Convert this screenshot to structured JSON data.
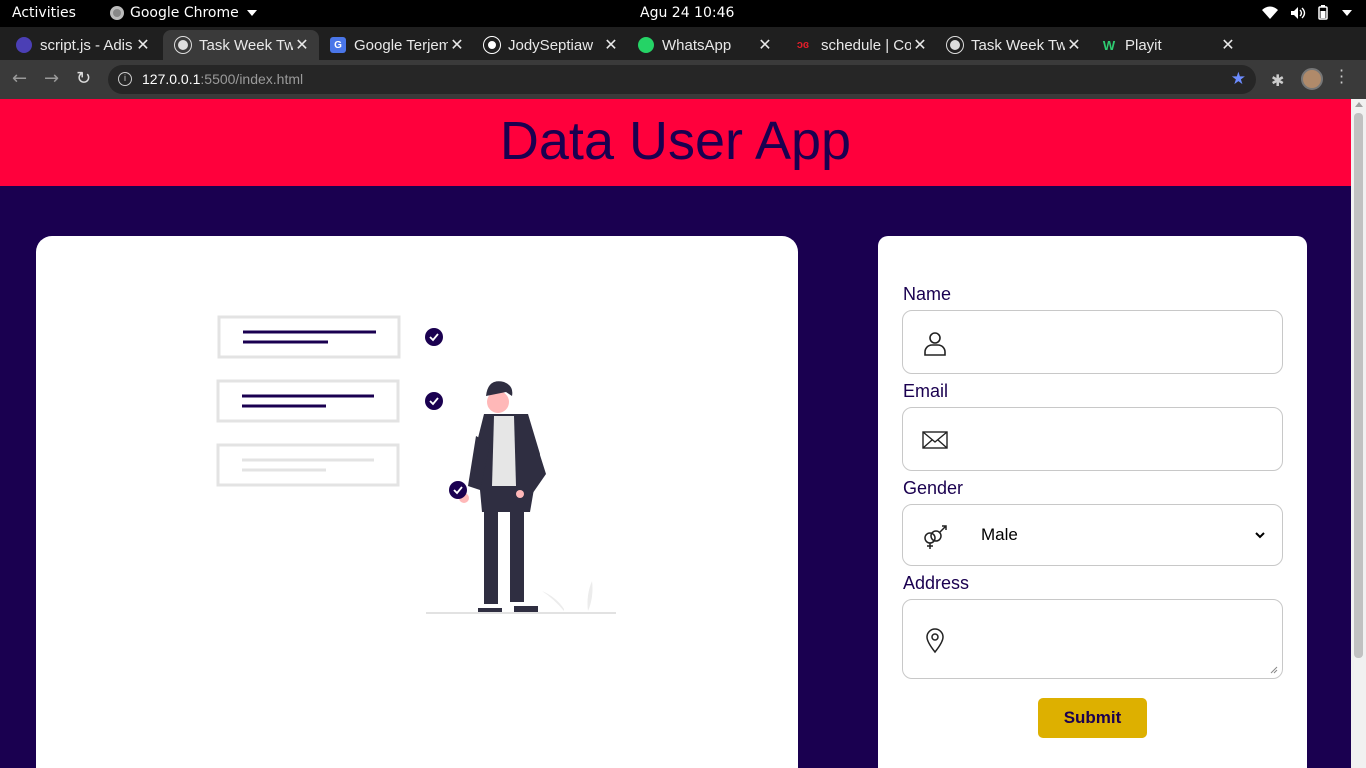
{
  "system": {
    "activities": "Activities",
    "app_name": "Google Chrome",
    "clock": "Agu 24  10:46"
  },
  "browser": {
    "tabs": [
      {
        "title": "script.js - Adis",
        "icon": "github-icon",
        "active": false
      },
      {
        "title": "Task Week Tw",
        "icon": "globe-icon",
        "active": true
      },
      {
        "title": "Google Terjem",
        "icon": "google-translate-icon",
        "active": false
      },
      {
        "title": "JodySeptiaw",
        "icon": "github-icon",
        "active": false
      },
      {
        "title": "WhatsApp",
        "icon": "whatsapp-icon",
        "active": false
      },
      {
        "title": "schedule | Co",
        "icon": "codepolitan-icon",
        "active": false
      },
      {
        "title": "Task Week Tw",
        "icon": "globe-icon",
        "active": false
      },
      {
        "title": "Playit",
        "icon": "playit-icon",
        "active": false
      }
    ],
    "url_host": "127.0.0.1",
    "url_path": ":5500/index.html"
  },
  "page": {
    "title": "Data User App",
    "form": {
      "name_label": "Name",
      "email_label": "Email",
      "gender_label": "Gender",
      "gender_value": "Male",
      "address_label": "Address",
      "submit_label": "Submit"
    }
  },
  "colors": {
    "header_bg": "#ff003c",
    "page_bg": "#1a0050",
    "accent_text": "#1a0050",
    "submit_bg": "#ddb000"
  }
}
